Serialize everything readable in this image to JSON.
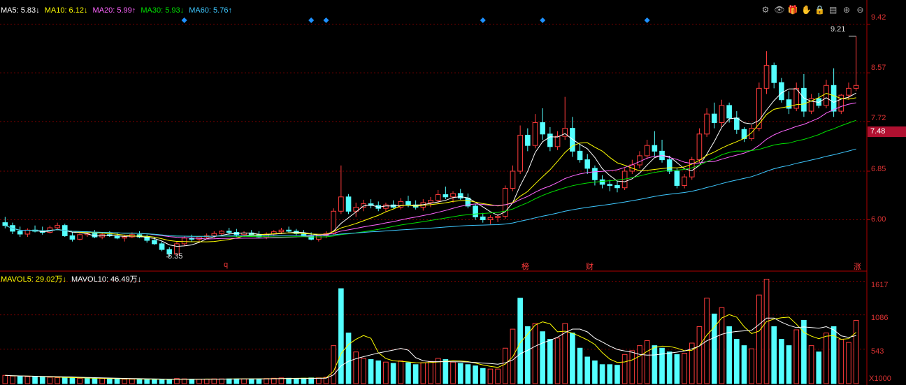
{
  "ma_header": {
    "ma5": "MA5: 5.83↓",
    "ma10": "MA10: 6.12↓",
    "ma20": "MA20: 5.99↑",
    "ma30": "MA30: 5.93↓",
    "ma60": "MA60: 5.76↑"
  },
  "vol_header": {
    "mavol5": "MAVOL5: 29.02万↓",
    "mavol10": "MAVOL10: 46.49万↓"
  },
  "toolbar": {
    "settings": "⚙",
    "eye": "👁",
    "gift": "🎁",
    "hand": "✋",
    "lock": "🔒",
    "layers": "▤",
    "zoom_in": "⊕",
    "zoom_out": "⊖"
  },
  "price_axis": {
    "t1": "9.42",
    "t2": "8.57",
    "t3": "7.72",
    "t4": "6.85",
    "t5": "6.00"
  },
  "current_price": "7.48",
  "vol_axis": {
    "t1": "1617",
    "t2": "1086",
    "t3": "543",
    "unit": "X1000"
  },
  "annotations": {
    "high": "9.21",
    "low": "5.35",
    "mark_q": "q",
    "mark_bang": "榜",
    "mark_cai": "财",
    "mark_zhang": "涨"
  },
  "colors": {
    "up": "#ff3b3b",
    "down": "#54ffff",
    "grid": "#7a0000",
    "ma5": "#ffffff",
    "ma10": "#ffff00",
    "ma20": "#ff66ff",
    "ma30": "#00e000",
    "ma60": "#3ec8ff",
    "diamond": "#1e90ff"
  },
  "chart_data": {
    "type": "candlestick",
    "price_ylim": [
      5.2,
      9.6
    ],
    "volume_ylim": [
      0,
      1700
    ],
    "volume_unit": "X1000",
    "ohlc": [
      [
        5.95,
        6.05,
        5.85,
        5.9
      ],
      [
        5.9,
        5.95,
        5.75,
        5.8
      ],
      [
        5.8,
        5.88,
        5.7,
        5.75
      ],
      [
        5.75,
        5.85,
        5.7,
        5.82
      ],
      [
        5.82,
        5.9,
        5.78,
        5.8
      ],
      [
        5.8,
        5.88,
        5.74,
        5.78
      ],
      [
        5.78,
        5.9,
        5.76,
        5.86
      ],
      [
        5.86,
        5.95,
        5.82,
        5.9
      ],
      [
        5.9,
        5.93,
        5.7,
        5.72
      ],
      [
        5.72,
        5.78,
        5.62,
        5.66
      ],
      [
        5.66,
        5.76,
        5.64,
        5.74
      ],
      [
        5.74,
        5.8,
        5.7,
        5.76
      ],
      [
        5.76,
        5.82,
        5.68,
        5.7
      ],
      [
        5.7,
        5.78,
        5.66,
        5.74
      ],
      [
        5.74,
        5.8,
        5.7,
        5.72
      ],
      [
        5.72,
        5.78,
        5.66,
        5.68
      ],
      [
        5.68,
        5.74,
        5.62,
        5.7
      ],
      [
        5.7,
        5.78,
        5.68,
        5.74
      ],
      [
        5.74,
        5.8,
        5.68,
        5.7
      ],
      [
        5.7,
        5.74,
        5.6,
        5.64
      ],
      [
        5.64,
        5.7,
        5.56,
        5.58
      ],
      [
        5.58,
        5.62,
        5.45,
        5.48
      ],
      [
        5.48,
        5.52,
        5.35,
        5.4
      ],
      [
        5.4,
        5.62,
        5.38,
        5.58
      ],
      [
        5.58,
        5.72,
        5.55,
        5.68
      ],
      [
        5.68,
        5.74,
        5.62,
        5.66
      ],
      [
        5.66,
        5.72,
        5.6,
        5.7
      ],
      [
        5.7,
        5.76,
        5.66,
        5.72
      ],
      [
        5.72,
        5.8,
        5.68,
        5.76
      ],
      [
        5.76,
        5.82,
        5.72,
        5.8
      ],
      [
        5.8,
        5.86,
        5.74,
        5.78
      ],
      [
        5.78,
        5.84,
        5.7,
        5.74
      ],
      [
        5.74,
        5.8,
        5.7,
        5.77
      ],
      [
        5.77,
        5.82,
        5.72,
        5.74
      ],
      [
        5.74,
        5.8,
        5.68,
        5.7
      ],
      [
        5.7,
        5.78,
        5.66,
        5.75
      ],
      [
        5.75,
        5.82,
        5.72,
        5.79
      ],
      [
        5.79,
        5.86,
        5.75,
        5.82
      ],
      [
        5.82,
        5.88,
        5.78,
        5.8
      ],
      [
        5.8,
        5.84,
        5.72,
        5.76
      ],
      [
        5.76,
        5.82,
        5.7,
        5.72
      ],
      [
        5.72,
        5.78,
        5.64,
        5.66
      ],
      [
        5.66,
        5.74,
        5.62,
        5.72
      ],
      [
        5.72,
        5.8,
        5.68,
        5.76
      ],
      [
        5.76,
        6.2,
        5.74,
        6.15
      ],
      [
        6.15,
        6.95,
        6.1,
        6.4
      ],
      [
        6.4,
        6.45,
        6.1,
        6.15
      ],
      [
        6.15,
        6.3,
        6.05,
        6.22
      ],
      [
        6.22,
        6.35,
        6.15,
        6.28
      ],
      [
        6.28,
        6.36,
        6.2,
        6.25
      ],
      [
        6.25,
        6.32,
        6.15,
        6.2
      ],
      [
        6.2,
        6.3,
        6.14,
        6.26
      ],
      [
        6.26,
        6.34,
        6.2,
        6.22
      ],
      [
        6.22,
        6.38,
        6.18,
        6.32
      ],
      [
        6.32,
        6.42,
        6.22,
        6.26
      ],
      [
        6.26,
        6.34,
        6.18,
        6.22
      ],
      [
        6.22,
        6.36,
        6.16,
        6.3
      ],
      [
        6.3,
        6.4,
        6.22,
        6.34
      ],
      [
        6.34,
        6.52,
        6.28,
        6.44
      ],
      [
        6.44,
        6.58,
        6.36,
        6.4
      ],
      [
        6.4,
        6.5,
        6.3,
        6.46
      ],
      [
        6.46,
        6.54,
        6.35,
        6.38
      ],
      [
        6.38,
        6.46,
        6.2,
        6.24
      ],
      [
        6.24,
        6.28,
        6.0,
        6.05
      ],
      [
        6.05,
        6.12,
        5.95,
        6.0
      ],
      [
        6.0,
        6.08,
        5.92,
        6.04
      ],
      [
        6.04,
        6.1,
        5.96,
        6.06
      ],
      [
        6.06,
        6.6,
        6.02,
        6.55
      ],
      [
        6.55,
        6.95,
        6.5,
        6.85
      ],
      [
        6.85,
        7.65,
        6.8,
        7.48
      ],
      [
        7.48,
        7.6,
        7.2,
        7.3
      ],
      [
        7.3,
        7.85,
        7.25,
        7.7
      ],
      [
        7.7,
        7.95,
        7.4,
        7.5
      ],
      [
        7.5,
        7.62,
        7.2,
        7.28
      ],
      [
        7.28,
        7.55,
        7.22,
        7.46
      ],
      [
        7.46,
        8.15,
        7.4,
        7.6
      ],
      [
        7.6,
        7.8,
        7.1,
        7.2
      ],
      [
        7.2,
        7.32,
        7.0,
        7.05
      ],
      [
        7.05,
        7.15,
        6.8,
        6.9
      ],
      [
        6.9,
        6.95,
        6.6,
        6.7
      ],
      [
        6.7,
        6.78,
        6.55,
        6.62
      ],
      [
        6.62,
        6.7,
        6.5,
        6.6
      ],
      [
        6.6,
        6.68,
        6.48,
        6.56
      ],
      [
        6.56,
        6.9,
        6.52,
        6.85
      ],
      [
        6.85,
        7.05,
        6.8,
        6.96
      ],
      [
        6.96,
        7.2,
        6.9,
        7.12
      ],
      [
        7.12,
        7.4,
        7.06,
        7.3
      ],
      [
        7.3,
        7.55,
        7.1,
        7.2
      ],
      [
        7.2,
        7.4,
        7.0,
        7.05
      ],
      [
        7.05,
        7.12,
        6.8,
        6.85
      ],
      [
        6.85,
        6.9,
        6.55,
        6.6
      ],
      [
        6.6,
        6.8,
        6.55,
        6.75
      ],
      [
        6.75,
        7.1,
        6.7,
        7.05
      ],
      [
        7.05,
        7.6,
        7.0,
        7.5
      ],
      [
        7.5,
        7.95,
        7.45,
        7.85
      ],
      [
        7.85,
        8.05,
        7.6,
        7.7
      ],
      [
        7.7,
        8.1,
        7.62,
        8.0
      ],
      [
        8.0,
        8.05,
        7.7,
        7.78
      ],
      [
        7.78,
        7.9,
        7.5,
        7.58
      ],
      [
        7.58,
        7.62,
        7.36,
        7.42
      ],
      [
        7.42,
        7.66,
        7.38,
        7.6
      ],
      [
        7.6,
        8.4,
        7.55,
        8.3
      ],
      [
        8.3,
        8.95,
        8.2,
        8.7
      ],
      [
        8.7,
        8.75,
        8.3,
        8.4
      ],
      [
        8.4,
        8.48,
        8.05,
        8.1
      ],
      [
        8.1,
        8.25,
        7.85,
        7.95
      ],
      [
        7.95,
        8.4,
        7.9,
        8.3
      ],
      [
        8.3,
        8.55,
        7.8,
        7.9
      ],
      [
        7.9,
        8.2,
        7.85,
        8.12
      ],
      [
        8.12,
        8.22,
        7.95,
        8.0
      ],
      [
        8.0,
        8.45,
        7.95,
        8.35
      ],
      [
        8.35,
        8.65,
        7.8,
        7.9
      ],
      [
        7.9,
        8.2,
        7.85,
        8.18
      ],
      [
        8.18,
        8.4,
        8.1,
        8.3
      ],
      [
        8.3,
        9.21,
        8.25,
        8.35
      ]
    ],
    "volumes": [
      [
        130,
        1
      ],
      [
        120,
        1
      ],
      [
        115,
        0
      ],
      [
        110,
        1
      ],
      [
        105,
        0
      ],
      [
        100,
        0
      ],
      [
        100,
        1
      ],
      [
        95,
        1
      ],
      [
        90,
        0
      ],
      [
        90,
        0
      ],
      [
        85,
        1
      ],
      [
        85,
        0
      ],
      [
        80,
        0
      ],
      [
        80,
        1
      ],
      [
        75,
        0
      ],
      [
        75,
        0
      ],
      [
        70,
        1
      ],
      [
        70,
        1
      ],
      [
        70,
        0
      ],
      [
        70,
        0
      ],
      [
        65,
        0
      ],
      [
        65,
        0
      ],
      [
        60,
        0
      ],
      [
        80,
        1
      ],
      [
        75,
        1
      ],
      [
        70,
        0
      ],
      [
        70,
        1
      ],
      [
        70,
        1
      ],
      [
        75,
        1
      ],
      [
        75,
        1
      ],
      [
        75,
        0
      ],
      [
        75,
        0
      ],
      [
        75,
        1
      ],
      [
        75,
        0
      ],
      [
        75,
        0
      ],
      [
        80,
        1
      ],
      [
        85,
        1
      ],
      [
        90,
        1
      ],
      [
        85,
        0
      ],
      [
        80,
        0
      ],
      [
        85,
        0
      ],
      [
        90,
        0
      ],
      [
        90,
        1
      ],
      [
        100,
        1
      ],
      [
        600,
        1
      ],
      [
        1500,
        0
      ],
      [
        800,
        0
      ],
      [
        500,
        1
      ],
      [
        400,
        1
      ],
      [
        380,
        0
      ],
      [
        360,
        0
      ],
      [
        340,
        1
      ],
      [
        320,
        0
      ],
      [
        360,
        1
      ],
      [
        330,
        0
      ],
      [
        300,
        0
      ],
      [
        330,
        1
      ],
      [
        350,
        1
      ],
      [
        400,
        1
      ],
      [
        380,
        0
      ],
      [
        340,
        1
      ],
      [
        320,
        0
      ],
      [
        300,
        0
      ],
      [
        280,
        0
      ],
      [
        240,
        0
      ],
      [
        230,
        1
      ],
      [
        230,
        1
      ],
      [
        560,
        1
      ],
      [
        860,
        1
      ],
      [
        1350,
        0
      ],
      [
        900,
        0
      ],
      [
        950,
        1
      ],
      [
        820,
        0
      ],
      [
        700,
        0
      ],
      [
        720,
        1
      ],
      [
        950,
        1
      ],
      [
        800,
        0
      ],
      [
        560,
        0
      ],
      [
        420,
        0
      ],
      [
        360,
        0
      ],
      [
        300,
        0
      ],
      [
        300,
        0
      ],
      [
        290,
        0
      ],
      [
        460,
        1
      ],
      [
        520,
        1
      ],
      [
        600,
        1
      ],
      [
        680,
        1
      ],
      [
        600,
        0
      ],
      [
        560,
        0
      ],
      [
        500,
        0
      ],
      [
        460,
        0
      ],
      [
        480,
        1
      ],
      [
        640,
        1
      ],
      [
        900,
        1
      ],
      [
        1350,
        1
      ],
      [
        1100,
        0
      ],
      [
        1200,
        1
      ],
      [
        900,
        0
      ],
      [
        700,
        0
      ],
      [
        600,
        0
      ],
      [
        550,
        1
      ],
      [
        1400,
        1
      ],
      [
        1650,
        1
      ],
      [
        900,
        0
      ],
      [
        700,
        0
      ],
      [
        600,
        0
      ],
      [
        850,
        1
      ],
      [
        1000,
        0
      ],
      [
        600,
        1
      ],
      [
        500,
        0
      ],
      [
        800,
        1
      ],
      [
        900,
        0
      ],
      [
        700,
        1
      ],
      [
        650,
        1
      ],
      [
        1000,
        1
      ]
    ],
    "diamond_indices": [
      24,
      41,
      43,
      64,
      72,
      86
    ]
  }
}
